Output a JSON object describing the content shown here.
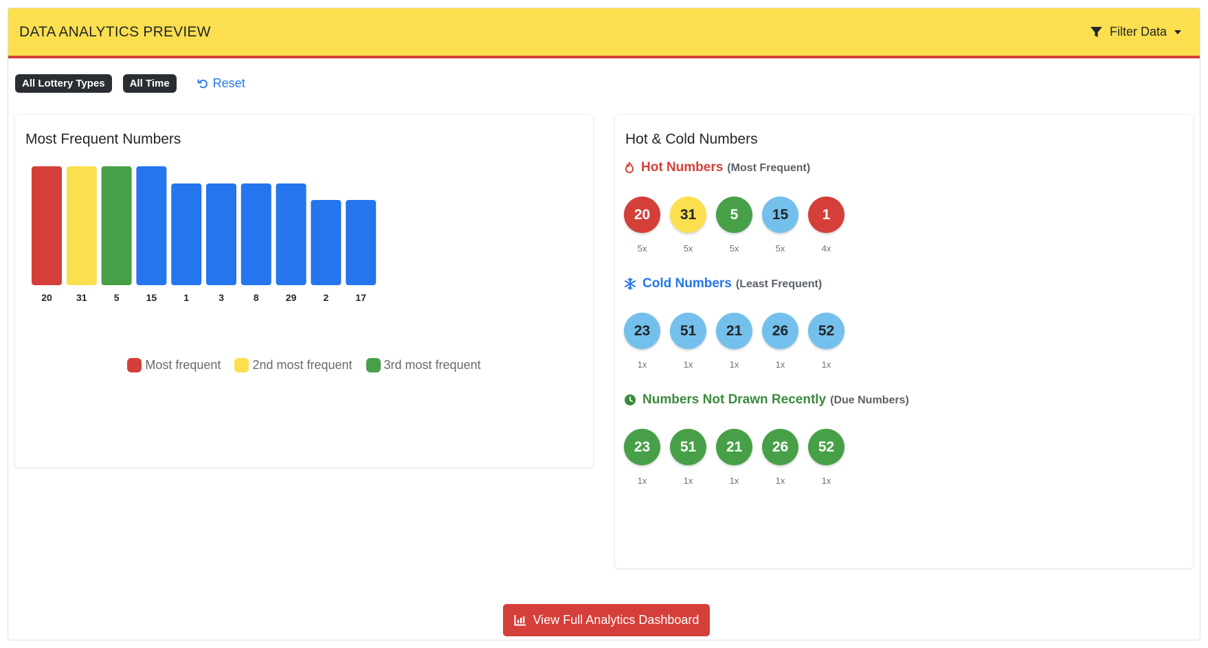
{
  "header": {
    "title": "DATA ANALYTICS PREVIEW",
    "filter_label": "Filter Data"
  },
  "filters": {
    "chips": [
      "All Lottery Types",
      "All Time"
    ],
    "reset_label": "Reset"
  },
  "frequent": {
    "title": "Most Frequent Numbers",
    "legend": [
      {
        "label": "Most frequent",
        "color": "#d53f39"
      },
      {
        "label": "2nd most frequent",
        "color": "#fbdf4f"
      },
      {
        "label": "3rd most frequent",
        "color": "#47a048"
      }
    ]
  },
  "chart_data": {
    "type": "bar",
    "title": "Most Frequent Numbers",
    "categories": [
      "20",
      "31",
      "5",
      "15",
      "1",
      "3",
      "8",
      "29",
      "2",
      "17"
    ],
    "values": [
      5,
      5,
      5,
      5,
      4,
      4,
      4,
      4,
      3,
      3
    ],
    "bar_colors": [
      "#d53f39",
      "#fbdf4f",
      "#47a048",
      "#2475ee",
      "#2475ee",
      "#2475ee",
      "#2475ee",
      "#2475ee",
      "#2475ee",
      "#2475ee"
    ],
    "ylim": [
      0,
      5
    ],
    "grid": false,
    "legend_position": "bottom"
  },
  "hot_cold": {
    "title": "Hot & Cold Numbers",
    "hot": {
      "label": "Hot Numbers",
      "sub": "(Most Frequent)",
      "color": "#d53f39",
      "balls": [
        {
          "n": "20",
          "count": "5x",
          "bg": "#d53f39",
          "fg": "#ffffff"
        },
        {
          "n": "31",
          "count": "5x",
          "bg": "#fbdf4f",
          "fg": "#212529"
        },
        {
          "n": "5",
          "count": "5x",
          "bg": "#47a048",
          "fg": "#ffffff"
        },
        {
          "n": "15",
          "count": "5x",
          "bg": "#74c0ec",
          "fg": "#212529"
        },
        {
          "n": "1",
          "count": "4x",
          "bg": "#d53f39",
          "fg": "#ffffff"
        }
      ]
    },
    "cold": {
      "label": "Cold Numbers",
      "sub": "(Least Frequent)",
      "color": "#2475ee",
      "balls": [
        {
          "n": "23",
          "count": "1x",
          "bg": "#74c0ec",
          "fg": "#212529"
        },
        {
          "n": "51",
          "count": "1x",
          "bg": "#74c0ec",
          "fg": "#212529"
        },
        {
          "n": "21",
          "count": "1x",
          "bg": "#74c0ec",
          "fg": "#212529"
        },
        {
          "n": "26",
          "count": "1x",
          "bg": "#74c0ec",
          "fg": "#212529"
        },
        {
          "n": "52",
          "count": "1x",
          "bg": "#74c0ec",
          "fg": "#212529"
        }
      ]
    },
    "due": {
      "label": "Numbers Not Drawn Recently",
      "sub": "(Due Numbers)",
      "color": "#3a8a3c",
      "balls": [
        {
          "n": "23",
          "count": "1x",
          "bg": "#47a048",
          "fg": "#ffffff"
        },
        {
          "n": "51",
          "count": "1x",
          "bg": "#47a048",
          "fg": "#ffffff"
        },
        {
          "n": "21",
          "count": "1x",
          "bg": "#47a048",
          "fg": "#ffffff"
        },
        {
          "n": "26",
          "count": "1x",
          "bg": "#47a048",
          "fg": "#ffffff"
        },
        {
          "n": "52",
          "count": "1x",
          "bg": "#47a048",
          "fg": "#ffffff"
        }
      ]
    }
  },
  "cta": {
    "label": "View Full Analytics Dashboard"
  }
}
